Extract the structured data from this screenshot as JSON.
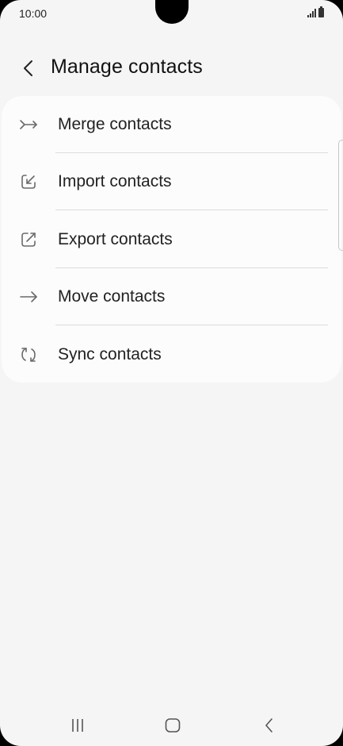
{
  "status_bar": {
    "time": "10:00",
    "icons": [
      "signal-icon",
      "battery-icon"
    ]
  },
  "header": {
    "back_icon": "chevron-left-icon",
    "title": "Manage contacts"
  },
  "menu": {
    "items": [
      {
        "label": "Merge contacts",
        "icon": "merge-icon"
      },
      {
        "label": "Import contacts",
        "icon": "import-icon"
      },
      {
        "label": "Export contacts",
        "icon": "export-icon"
      },
      {
        "label": "Move contacts",
        "icon": "arrow-right-icon"
      },
      {
        "label": "Sync contacts",
        "icon": "sync-icon"
      }
    ]
  },
  "nav_bar": {
    "icons": [
      "recent-apps-icon",
      "home-icon",
      "back-icon"
    ]
  },
  "colors": {
    "background": "#f5f5f5",
    "card": "#fcfcfc",
    "text": "#222222",
    "icon": "#6a6a6a",
    "divider": "#dcdcdc"
  }
}
